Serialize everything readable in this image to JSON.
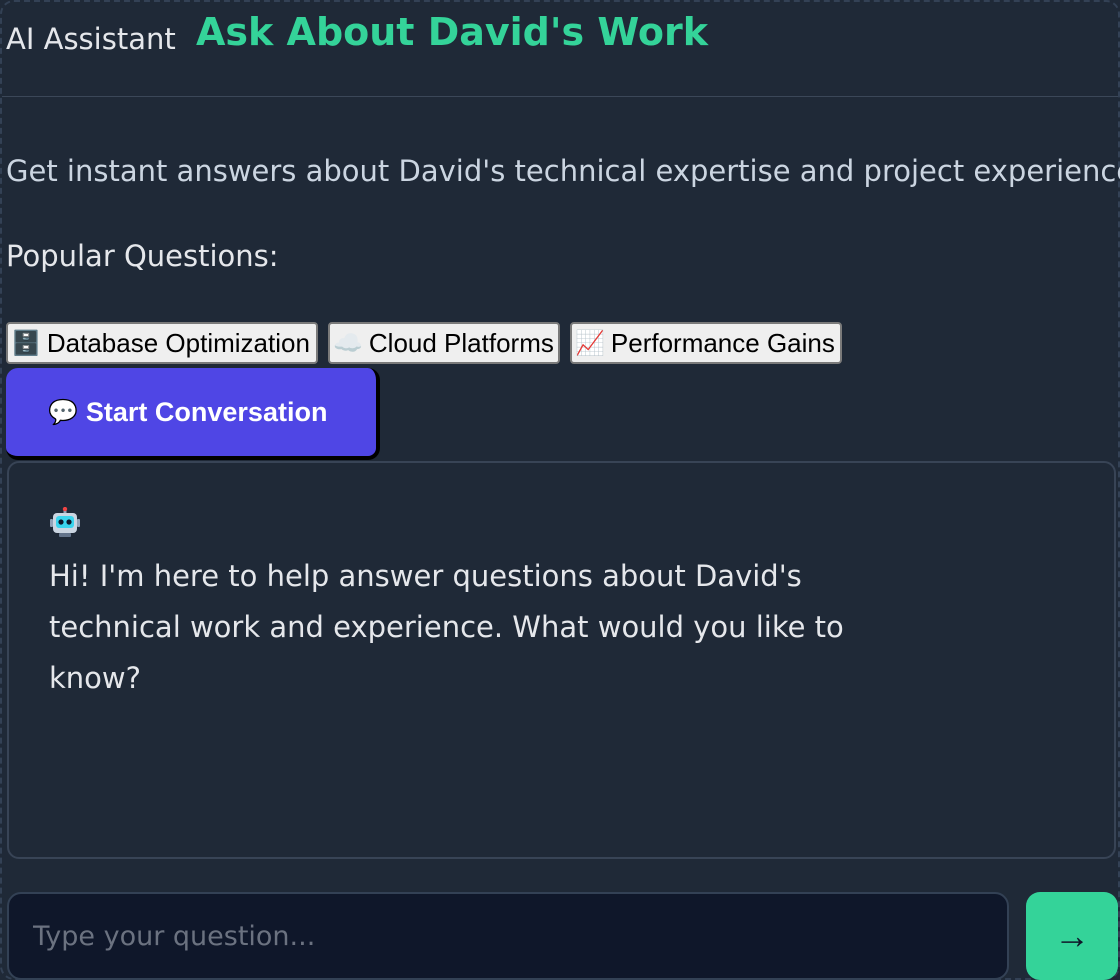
{
  "header": {
    "label": "AI Assistant",
    "title": "Ask About David's Work"
  },
  "intro": {
    "subtitle": "Get instant answers about David's technical expertise and project experience",
    "popular_label": "Popular Questions:"
  },
  "popular_questions": [
    {
      "emoji": "🗄️",
      "label": "Database Optimization",
      "icon": "file-cabinet-icon"
    },
    {
      "emoji": "☁️",
      "label": "Cloud Platforms",
      "icon": "cloud-icon"
    },
    {
      "emoji": "📈",
      "label": "Performance Gains",
      "icon": "chart-up-icon"
    }
  ],
  "start_button": {
    "emoji": "💬",
    "label": "Start Conversation",
    "icon": "speech-bubble-icon"
  },
  "chat": {
    "bot_icon": "robot-icon",
    "bot_message": "Hi! I'm here to help answer questions about David's technical work and experience. What would you like to know?"
  },
  "input": {
    "placeholder": "Type your question...",
    "value": ""
  },
  "send_button": {
    "symbol": "→",
    "icon": "arrow-right-icon"
  },
  "colors": {
    "background": "#1f2937",
    "accent_green": "#34d399",
    "accent_indigo": "#4f46e5",
    "input_bg": "#0f172a"
  }
}
